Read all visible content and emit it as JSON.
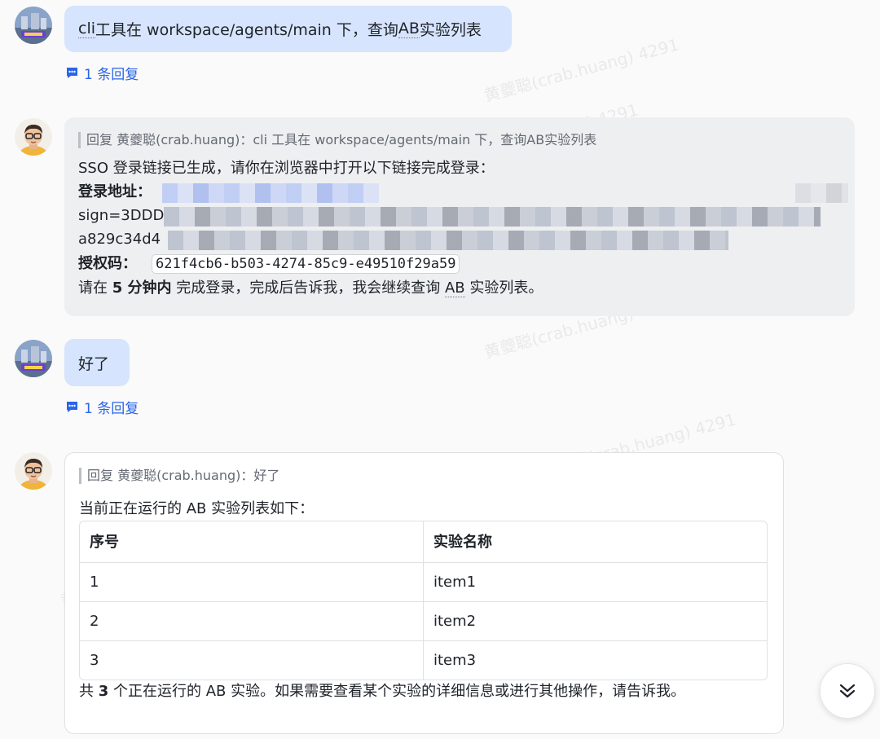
{
  "watermark": "黄夔聪(crab.huang) 4291",
  "messages": {
    "user1": {
      "pre": "cli",
      "mid": " 工具在 workspace/agents/main 下，查询",
      "ab": "AB",
      "post": "实验列表"
    },
    "reply1": {
      "label": "1 条回复"
    },
    "bot1": {
      "quote": "回复 黄夔聪(crab.huang)：cli 工具在 workspace/agents/main 下，查询AB实验列表",
      "intro": "SSO 登录链接已生成，请你在浏览器中打开以下链接完成登录：",
      "login_label": "登录地址：",
      "sign_prefix": "sign=3DDD",
      "hash_prefix": "a829c34d4",
      "auth_label": "授权码：",
      "auth_code": "621f4cb6-b503-4274-85c9-e49510f29a59",
      "note_pre": "请在 ",
      "note_bold": "5 分钟内",
      "note_mid": " 完成登录，完成后告诉我，我会继续查询 ",
      "note_ab": "AB",
      "note_post": " 实验列表。"
    },
    "user2": {
      "text": "好了"
    },
    "reply2": {
      "label": "1 条回复"
    },
    "bot2": {
      "quote": "回复 黄夔聪(crab.huang)：好了",
      "intro": "当前正在运行的 AB 实验列表如下：",
      "table": {
        "headers": [
          "序号",
          "实验名称"
        ],
        "rows": [
          [
            "1",
            "item1"
          ],
          [
            "2",
            "item2"
          ],
          [
            "3",
            "item3"
          ]
        ]
      },
      "summary_pre": "共 ",
      "summary_bold": "3",
      "summary_post": " 个正在运行的 AB 实验。如果需要查看某个实验的详细信息或进行其他操作，请告诉我。"
    }
  },
  "colors": {
    "accent": "#2a64e8",
    "user_bubble": "#d6e4fd",
    "bot_bubble": "#eeeff1"
  }
}
